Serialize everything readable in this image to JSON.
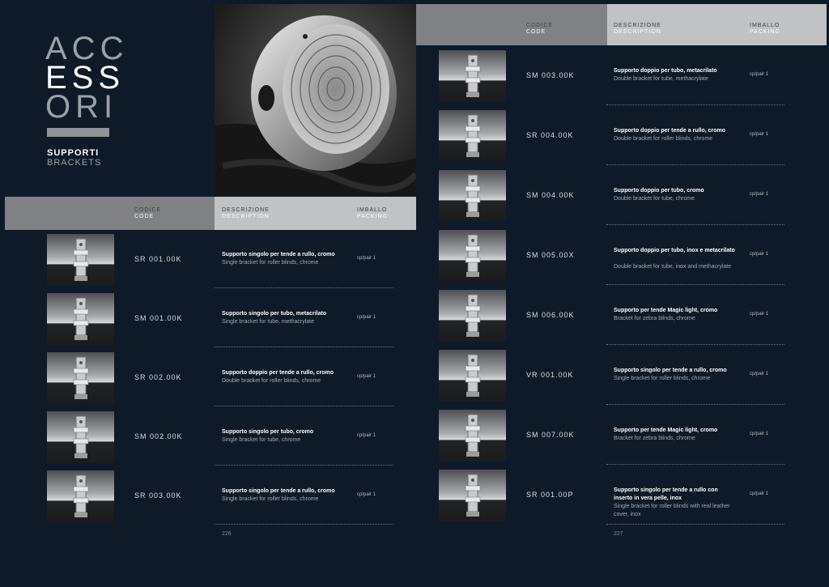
{
  "title": {
    "line1": "ACC",
    "line2": "ESS",
    "line3": "ORI"
  },
  "subtitle": {
    "it": "SUPPORTI",
    "en": "BRACKETS"
  },
  "headers": {
    "code_it": "CODICE",
    "code_en": "CODE",
    "desc_it": "DESCRIZIONE",
    "desc_en": "DESCRIPTION",
    "pack_it": "IMBALLO",
    "pack_en": "PACKING"
  },
  "left_items": [
    {
      "code": "SR 001.00K",
      "desc_it": "Supporto singolo per tende a rullo, cromo",
      "desc_en": "Single bracket for roller blinds, chrome",
      "pack": "cp/pair 1"
    },
    {
      "code": "SM 001.00K",
      "desc_it": "Supporto singolo per tubo, metacrilato",
      "desc_en": "Single bracket for tube, methacrylate",
      "pack": "cp/pair 1"
    },
    {
      "code": "SR 002.00K",
      "desc_it": "Supporto doppio per tende a rullo, cromo",
      "desc_en": "Double bracket for roller blinds, chrome",
      "pack": "cp/pair 1"
    },
    {
      "code": "SM 002.00K",
      "desc_it": "Supporto singolo per tubo, cromo",
      "desc_en": "Single bracket for tube, chrome",
      "pack": "cp/pair 1"
    },
    {
      "code": "SR 003.00K",
      "desc_it": "Supporto singolo per tende a rullo, cromo",
      "desc_en": "Single bracket for roller blinds, chrome",
      "pack": "cp/pair 1"
    }
  ],
  "right_items": [
    {
      "code": "SM 003.00K",
      "desc_it": "Supporto doppio per tubo, metacrilato",
      "desc_en": "Double bracket for tube, methacrylate",
      "pack": "cp/pair 1"
    },
    {
      "code": "SR 004.00K",
      "desc_it": "Supporto doppio per tende a rullo, cromo",
      "desc_en": "Double bracket for roller blinds, chrome",
      "pack": "cp/pair 1"
    },
    {
      "code": "SM 004.00K",
      "desc_it": "Supporto doppio per tubo, cromo",
      "desc_en": "Double bracket for tube, chrome",
      "pack": "cp/pair 1"
    },
    {
      "code": "SM 005.00X",
      "desc_it": "Supporto doppio per tubo, inox e metacrilato",
      "desc_en": "Double bracket for tube, inox and methacrylate",
      "pack": "cp/pair 1"
    },
    {
      "code": "SM 006.00K",
      "desc_it": "Supporto per tende Magic light, cromo",
      "desc_en": "Bracket for zebra blinds, chrome",
      "pack": "cp/pair 1"
    },
    {
      "code": "VR 001.00K",
      "desc_it": "Supporto singolo per tende a rullo, cromo",
      "desc_en": "Single bracket for roller blinds, chrome",
      "pack": "cp/pair 1"
    },
    {
      "code": "SM 007.00K",
      "desc_it": "Supporto per tende Magic light, cromo",
      "desc_en": "Bracket for zebra blinds, chrome",
      "pack": "cp/pair 1"
    },
    {
      "code": "SR 001.00P",
      "desc_it": "Supporto singolo per tende a rullo con inserto in vera pelle, inox",
      "desc_en": "Single bracket for roller blinds with real leather cover, inox",
      "pack": "cp/pair 1"
    }
  ],
  "page_numbers": {
    "left": "226",
    "right": "227"
  }
}
